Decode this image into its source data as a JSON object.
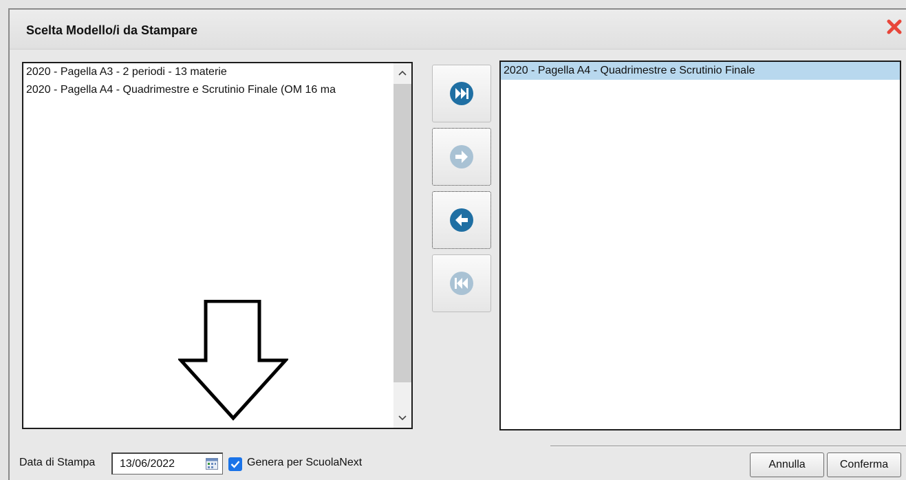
{
  "dialog": {
    "title": "Scelta Modello/i da Stampare"
  },
  "available_list": {
    "items": [
      "2020 - Pagella A3 - 2 periodi - 13 materie",
      "2020 - Pagella A4 - Quadrimestre e Scrutinio Finale (OM 16 ma"
    ]
  },
  "selected_list": {
    "items": [
      "2020 - Pagella A4 - Quadrimestre e Scrutinio Finale"
    ]
  },
  "move_buttons": [
    {
      "icon": "move-all-right-icon",
      "enabled": true
    },
    {
      "icon": "move-right-icon",
      "enabled": false
    },
    {
      "icon": "move-left-icon",
      "enabled": true
    },
    {
      "icon": "move-all-left-icon",
      "enabled": false
    }
  ],
  "footer": {
    "date_label": "Data di Stampa",
    "date_value": "13/06/2022",
    "checkbox_label": "Genera per ScuolaNext",
    "checkbox_checked": true,
    "cancel_label": "Annulla",
    "confirm_label": "Conferma"
  },
  "colors": {
    "accent_blue": "#1f6fa3",
    "disabled_blue": "#a9c2d4",
    "close_red": "#e8463a",
    "selection": "#b8d8ee"
  }
}
